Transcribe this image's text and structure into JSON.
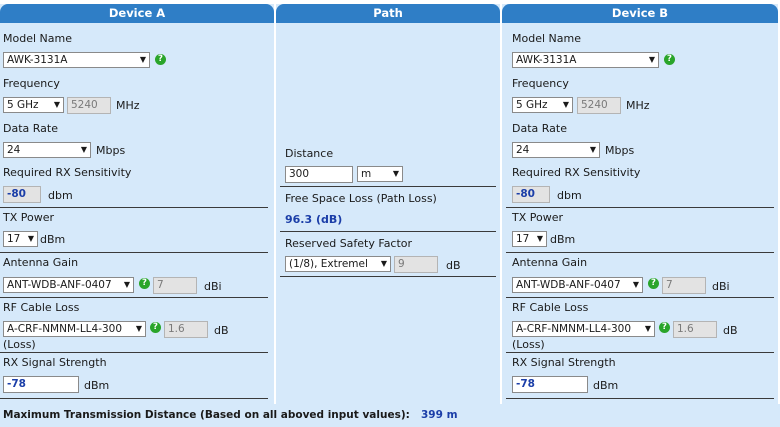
{
  "headers": {
    "a": "Device A",
    "path": "Path",
    "b": "Device B"
  },
  "device_a": {
    "model_label": "Model Name",
    "model_value": "AWK-3131A",
    "freq_label": "Frequency",
    "freq_value": "5 GHz",
    "freq_channel": "5240",
    "freq_unit": "MHz",
    "rate_label": "Data Rate",
    "rate_value": "24",
    "rate_unit": "Mbps",
    "rx_label": "Required RX Sensitivity",
    "rx_value": "-80",
    "rx_unit": "dbm",
    "tx_label": "TX Power",
    "tx_value": "17",
    "tx_unit": "dBm",
    "ant_label": "Antenna Gain",
    "ant_value": "ANT-WDB-ANF-0407",
    "ant_gain": "7",
    "ant_unit": "dBi",
    "cable_label": "RF Cable Loss",
    "cable_value": "A-CRF-NMNM-LL4-300",
    "cable_loss": "1.6",
    "cable_unit": "dB",
    "cable_note": "(Loss)",
    "sig_label": "RX Signal Strength",
    "sig_value": "-78",
    "sig_unit": "dBm"
  },
  "path": {
    "distance_label": "Distance",
    "distance_value": "300",
    "distance_unit": "m",
    "fsl_label": "Free Space Loss (Path Loss)",
    "fsl_value": "96.3 (dB)",
    "safety_label": "Reserved Safety Factor",
    "safety_value": "(1/8), Extremel",
    "safety_db": "9",
    "safety_unit": "dB"
  },
  "device_b": {
    "model_label": "Model Name",
    "model_value": "AWK-3131A",
    "freq_label": "Frequency",
    "freq_value": "5 GHz",
    "freq_channel": "5240",
    "freq_unit": "MHz",
    "rate_label": "Data Rate",
    "rate_value": "24",
    "rate_unit": "Mbps",
    "rx_label": "Required RX Sensitivity",
    "rx_value": "-80",
    "rx_unit": "dbm",
    "tx_label": "TX Power",
    "tx_value": "17",
    "tx_unit": "dBm",
    "ant_label": "Antenna Gain",
    "ant_value": "ANT-WDB-ANF-0407",
    "ant_gain": "7",
    "ant_unit": "dBi",
    "cable_label": "RF Cable Loss",
    "cable_value": "A-CRF-NMNM-LL4-300",
    "cable_loss": "1.6",
    "cable_unit": "dB",
    "cable_note": "(Loss)",
    "sig_label": "RX Signal Strength",
    "sig_value": "-78",
    "sig_unit": "dBm"
  },
  "footer": {
    "label": "Maximum Transmission Distance (Based on all aboved input values):",
    "value": "399 m"
  },
  "icons": {
    "help": "?",
    "dropdown": "▼"
  },
  "colors": {
    "header": "#2f7ec6",
    "panel": "#d6e9fa",
    "accent_value": "#1b3ea8",
    "help": "#2aa52a"
  }
}
